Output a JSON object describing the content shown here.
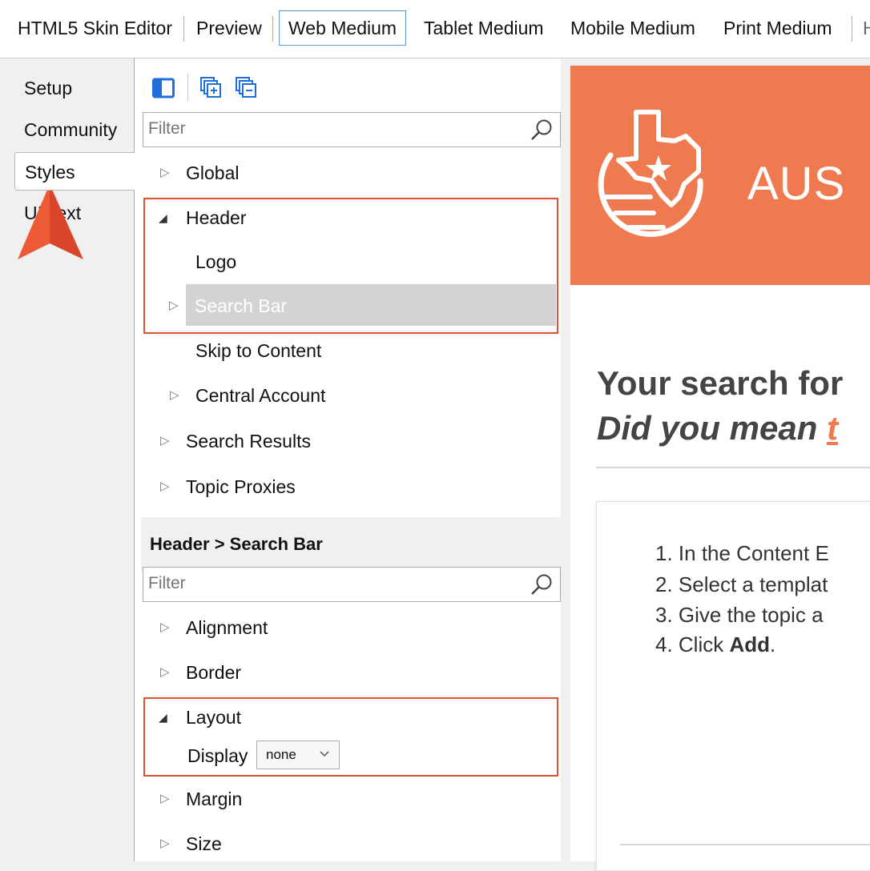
{
  "toolbar": {
    "items": [
      "HTML5 Skin Editor",
      "Preview",
      "Web Medium",
      "Tablet Medium",
      "Mobile Medium",
      "Print Medium",
      "H"
    ]
  },
  "sidebar": {
    "tabs": [
      "Setup",
      "Community",
      "Styles",
      "UI Text"
    ]
  },
  "tree": {
    "filter_placeholder": "Filter",
    "items": [
      "Global",
      "Header",
      "Logo",
      "Search Bar",
      "Skip to Content",
      "Central Account",
      "Search Results",
      "Topic Proxies"
    ]
  },
  "props": {
    "breadcrumb": "Header > Search Bar",
    "filter_placeholder": "Filter",
    "items": [
      "Alignment",
      "Border",
      "Layout",
      "Margin",
      "Size"
    ],
    "display_label": "Display",
    "display_value": "none"
  },
  "preview": {
    "logo_text": "AUS",
    "heading_line1": "Your search for",
    "heading_line2_prefix": "Did you mean ",
    "heading_link": "t",
    "steps": [
      "1. In the Content E",
      "2. Select a templat",
      "3. Give the topic a",
      "4. Click "
    ],
    "step4_bold": "Add",
    "step4_suffix": "."
  },
  "colors": {
    "accent_orange": "#f07a4f",
    "highlight_red": "#d9542f",
    "selected_tab_border": "#5b9bd5"
  }
}
